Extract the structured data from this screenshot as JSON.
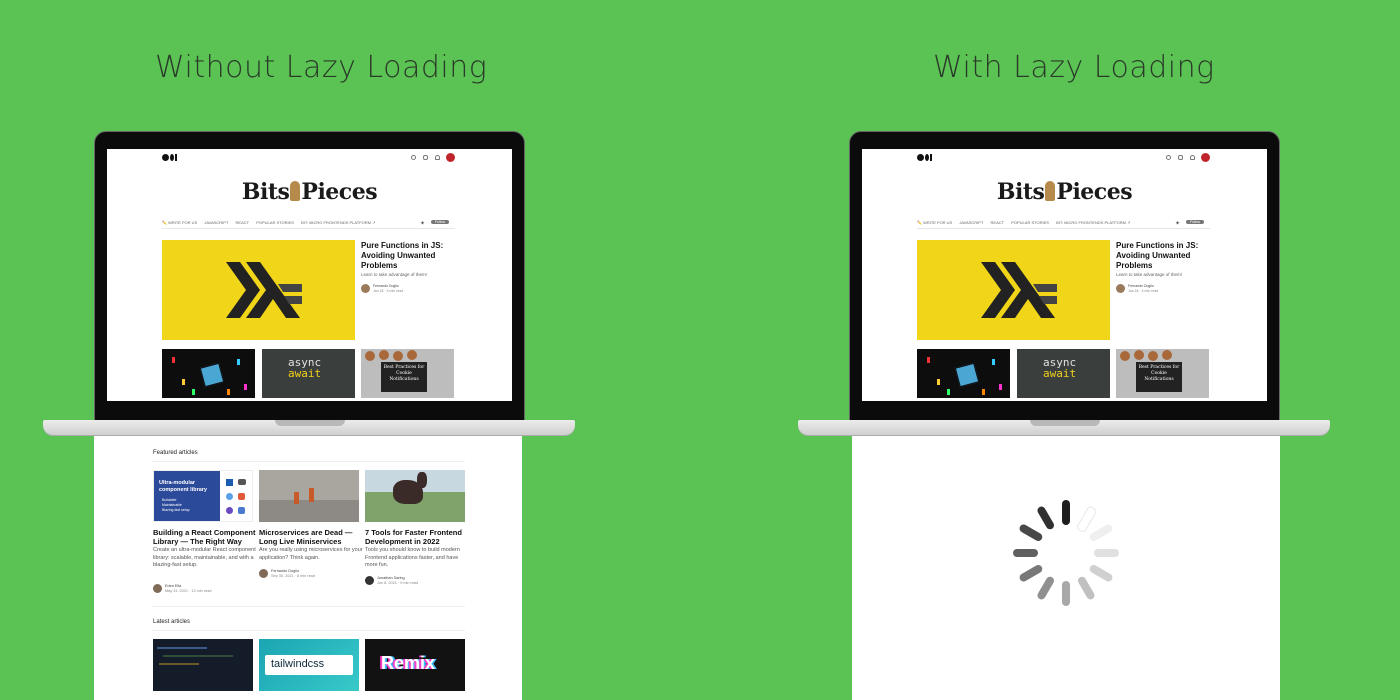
{
  "panels": {
    "left_title": "Without Lazy Loading",
    "right_title": "With Lazy Loading"
  },
  "blog": {
    "brand_left": "Bits",
    "brand_right": "Pieces",
    "nav": [
      "✏️ WRITE FOR US",
      "JAVASCRIPT",
      "REACT",
      "POPULAR STORIES",
      "BIT: MICRO FRONTENDS PLATFORM ↗"
    ],
    "follow_label": "Follow",
    "hero": {
      "title": "Pure Functions in JS: Avoiding Unwanted Problems",
      "subtitle": "Learn to take advantage of them!",
      "author": "Fernando Doglio",
      "date": "Jan 18 · 4 min read"
    },
    "thumbs": {
      "async": "async",
      "await": "await",
      "cookie_card": "Best Practices for Cookie Notifications"
    }
  },
  "below_fold": {
    "featured_label": "Featured articles",
    "latest_label": "Latest articles",
    "featured": [
      {
        "title": "Building a React Component Library — The Right Way",
        "desc": "Create an ultra-modular React component library: scalable, maintainable, and with a blazing-fast setup.",
        "author": "Eden Ella",
        "date": "May 31, 2021 · 13 min read",
        "img_heading": "Ultra-modular component library",
        "img_items": [
          "Buildable",
          "Maintainable",
          "Blazing fast setup"
        ]
      },
      {
        "title": "Microservices are Dead — Long Live Miniservices",
        "desc": "Are you really using microservices for your application? Think again.",
        "author": "Fernando Doglio",
        "date": "Sep 30, 2021 · 8 min read"
      },
      {
        "title": "7 Tools for Faster Frontend Development in 2022",
        "desc": "Tools you should know to build modern Frontend applications faster, and have more fun.",
        "author": "Jonathan Saring",
        "date": "Jun 8, 2021 · 9 min read"
      }
    ],
    "latest_imgs": [
      "",
      "tailwindcss",
      "Remix"
    ]
  },
  "colors": {
    "background": "#5bc354",
    "hero_yellow": "#f0d518",
    "avatar_red": "#c0242a"
  }
}
